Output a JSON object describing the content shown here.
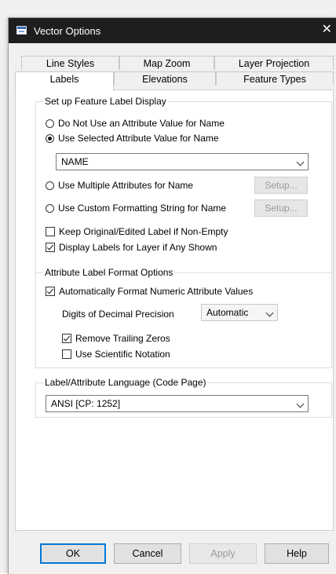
{
  "window": {
    "title": "Vector Options",
    "close_glyph": "✕"
  },
  "tabs": {
    "row1": [
      "Line Styles",
      "Map Zoom",
      "Layer Projection"
    ],
    "row2": [
      "Labels",
      "Elevations",
      "Feature Types"
    ],
    "active": "Labels"
  },
  "label_display": {
    "group_title": "Set up Feature Label Display",
    "opt_no_attr": "Do Not Use an Attribute Value for Name",
    "opt_selected_attr": "Use Selected Attribute Value for Name",
    "attr_combo_value": "NAME",
    "opt_multiple_attr": "Use Multiple Attributes for Name",
    "opt_custom_format": "Use Custom Formatting String for Name",
    "setup_label": "Setup...",
    "selected_option": "opt_selected_attr",
    "keep_original_label": "Keep Original/Edited Label if Non-Empty",
    "keep_original_checked": false,
    "display_labels": "Display Labels for Layer if Any Shown",
    "display_labels_checked": true
  },
  "format_options": {
    "group_title": "Attribute Label Format Options",
    "auto_format": "Automatically Format Numeric Attribute Values",
    "auto_format_checked": true,
    "digits_label": "Digits of Decimal Precision",
    "digits_value": "Automatic",
    "remove_zeros": "Remove Trailing Zeros",
    "remove_zeros_checked": true,
    "sci_notation": "Use Scientific Notation",
    "sci_notation_checked": false
  },
  "language": {
    "group_title": "Label/Attribute Language (Code Page)",
    "value": "ANSI [CP: 1252]"
  },
  "buttons": {
    "ok": "OK",
    "cancel": "Cancel",
    "apply": "Apply",
    "help": "Help"
  },
  "colors": {
    "titlebar": "#1e1e1e",
    "default_button_border": "#0078d7"
  }
}
